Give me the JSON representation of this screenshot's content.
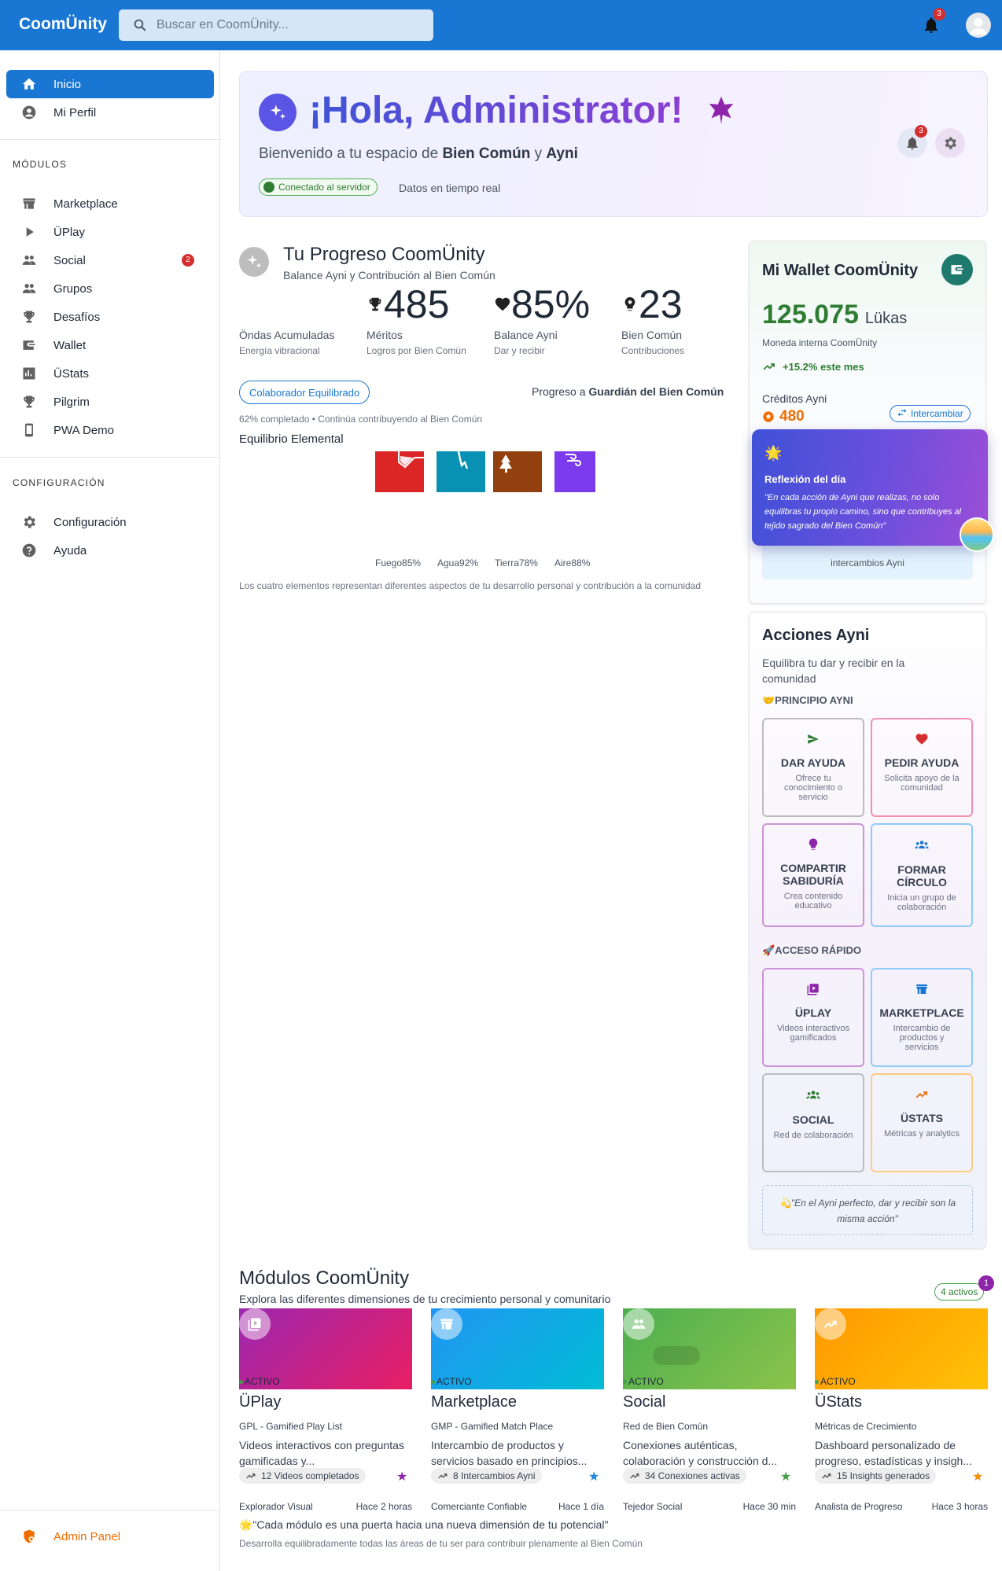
{
  "topbar": {
    "logo": "CoomÜnity",
    "search_placeholder": "Buscar en CoomÜnity...",
    "notif_count": "3"
  },
  "sidebar": {
    "items": [
      {
        "label": "Inicio"
      },
      {
        "label": "Mi Perfil"
      }
    ],
    "modules_label": "MÓDULOS",
    "modules": [
      {
        "label": "Marketplace"
      },
      {
        "label": "ÜPlay"
      },
      {
        "label": "Social",
        "badge": "2"
      },
      {
        "label": "Grupos"
      },
      {
        "label": "Desafíos"
      },
      {
        "label": "Wallet"
      },
      {
        "label": "ÜStats"
      },
      {
        "label": "Pilgrim"
      },
      {
        "label": "PWA Demo"
      }
    ],
    "config_label": "CONFIGURACIÓN",
    "config": [
      {
        "label": "Configuración"
      },
      {
        "label": "Ayuda"
      }
    ],
    "admin": "Admin Panel"
  },
  "hero": {
    "title": "¡Hola, Administrator!",
    "sub_pre": "Bienvenido a tu espacio de ",
    "sub_b1": "Bien Común",
    "sub_mid": " y ",
    "sub_b2": "Ayni",
    "status": "Conectado al servidor",
    "realtime": "Datos en tiempo real",
    "notif": "3"
  },
  "progress": {
    "title": "Tu Progreso CoomÜnity",
    "subtitle": "Balance Ayni y Contribución al Bien Común",
    "stats": [
      {
        "value": "",
        "label": "Öndas Acumuladas",
        "sub": "Energía vibracional"
      },
      {
        "value": "485",
        "label": "Méritos",
        "sub": "Logros por Bien Común"
      },
      {
        "value": "85%",
        "label": "Balance Ayni",
        "sub": "Dar y recibir"
      },
      {
        "value": "23",
        "label": "Bien Común",
        "sub": "Contribuciones"
      }
    ],
    "level_chip": "Colaborador Equilibrado",
    "progress_pre": "Progreso a ",
    "progress_target": "Guardián del Bien Común",
    "progress_note": "62% completado • Continúa contribuyendo al Bien Común",
    "elements_title": "Equilibrio Elemental",
    "elements": [
      {
        "name": "Fuego",
        "pct": "85%",
        "color": "#dc2626"
      },
      {
        "name": "Agua",
        "pct": "92%",
        "color": "#0891b2"
      },
      {
        "name": "Tierra",
        "pct": "78%",
        "color": "#92400e"
      },
      {
        "name": "Aire",
        "pct": "88%",
        "color": "#7c3aed"
      }
    ],
    "elements_note": "Los cuatro elementos representan diferentes aspectos de tu desarrollo personal y contribución a la comunidad"
  },
  "wallet": {
    "title": "Mi Wallet CoomÜnity",
    "amount": "125.075",
    "unit": "Lükas",
    "currency_desc": "Moneda interna CoomÜnity",
    "trend": "+15.2% este mes",
    "credits_label": "Créditos Ayni",
    "credits": "480",
    "exchange_btn": "Intercambiar",
    "hidden_text": "intercambios Ayni"
  },
  "reflection": {
    "title": "Reflexión del día",
    "text": "\"En cada acción de Ayni que realizas, no solo equilibras tu propio camino, sino que contribuyes al tejido sagrado del Bien Común\""
  },
  "acciones": {
    "title": "Acciones Ayni",
    "subtitle": "Equilibra tu dar y recibir en la comunidad",
    "principle_label": "🤝PRINCIPIO AYNI",
    "principle": [
      {
        "title": "DAR AYUDA",
        "desc": "Ofrece tu conocimiento o servicio",
        "color": "#9e9e9e",
        "icon": "send-icon"
      },
      {
        "title": "PEDIR AYUDA",
        "desc": "Solicita apoyo de la comunidad",
        "color": "#f48fb1",
        "icon": "heart-icon"
      },
      {
        "title": "COMPARTIR SABIDURÍA",
        "desc": "Crea contenido educativo",
        "color": "#ce93d8",
        "icon": "lightbulb-icon"
      },
      {
        "title": "FORMAR CÍRCULO",
        "desc": "Inicia un grupo de colaboración",
        "color": "#90caf9",
        "icon": "group-icon"
      }
    ],
    "quick_label": "🚀ACCESO RÁPIDO",
    "quick": [
      {
        "title": "ÜPLAY",
        "desc": "Videos interactivos gamificados",
        "color": "#ce93d8",
        "icon": "play-icon"
      },
      {
        "title": "MARKETPLACE",
        "desc": "Intercambio de productos y servicios",
        "color": "#90caf9",
        "icon": "store-icon"
      },
      {
        "title": "SOCIAL",
        "desc": "Red de colaboración",
        "color": "#a5d6a7",
        "icon": "people-icon"
      },
      {
        "title": "ÜSTATS",
        "desc": "Métricas y analytics",
        "color": "#ffcc80",
        "icon": "trending-icon"
      }
    ],
    "quote": "💫\"En el Ayni perfecto, dar y recibir son la misma acción\""
  },
  "modules": {
    "title": "Módulos CoomÜnity",
    "subtitle": "Explora las diferentes dimensiones de tu crecimiento personal y comunitario",
    "active_chip": "4 activos",
    "active_badge": "1",
    "cards": [
      {
        "name": "ÜPlay",
        "code": "GPL - Gamified Play List",
        "desc": "Videos interactivos con preguntas gamificadas y...",
        "chip": "12 Videos completados",
        "role": "Explorador Visual",
        "time": "Hace 2 horas",
        "status": "ACTIVO",
        "star_color": "#8e24aa",
        "grad": "linear-gradient(135deg,#9c27b0,#e91e63)"
      },
      {
        "name": "Marketplace",
        "code": "GMP - Gamified Match Place",
        "desc": "Intercambio de productos y servicios basado en principios...",
        "chip": "8 Intercambios Ayni",
        "role": "Comerciante Confiable",
        "time": "Hace 1 día",
        "status": "ACTIVO",
        "star_color": "#1e88e5",
        "grad": "linear-gradient(135deg,#2196f3,#00bcd4)"
      },
      {
        "name": "Social",
        "code": "Red de Bien Común",
        "desc": "Conexiones auténticas, colaboración y construcción d...",
        "chip": "34 Conexiones activas",
        "role": "Tejedor Social",
        "time": "Hace 30 min",
        "status": "ACTIVO",
        "star_color": "#43a047",
        "grad": "linear-gradient(135deg,#4caf50,#8bc34a)"
      },
      {
        "name": "ÜStats",
        "code": "Métricas de Crecimiento",
        "desc": "Dashboard personalizado de progreso, estadísticas y insigh...",
        "chip": "15 Insights generados",
        "role": "Analista de Progreso",
        "time": "Hace 3 horas",
        "status": "ACTIVO",
        "star_color": "#fb8c00",
        "grad": "linear-gradient(135deg,#ff9800,#ffc107)"
      }
    ],
    "quote": "🌟\"Cada módulo es una puerta hacia una nueva dimensión de tu potencial\"",
    "quote_sub": "Desarrolla equilibradamente todas las áreas de tu ser para contribuir plenamente al Bien Común"
  }
}
